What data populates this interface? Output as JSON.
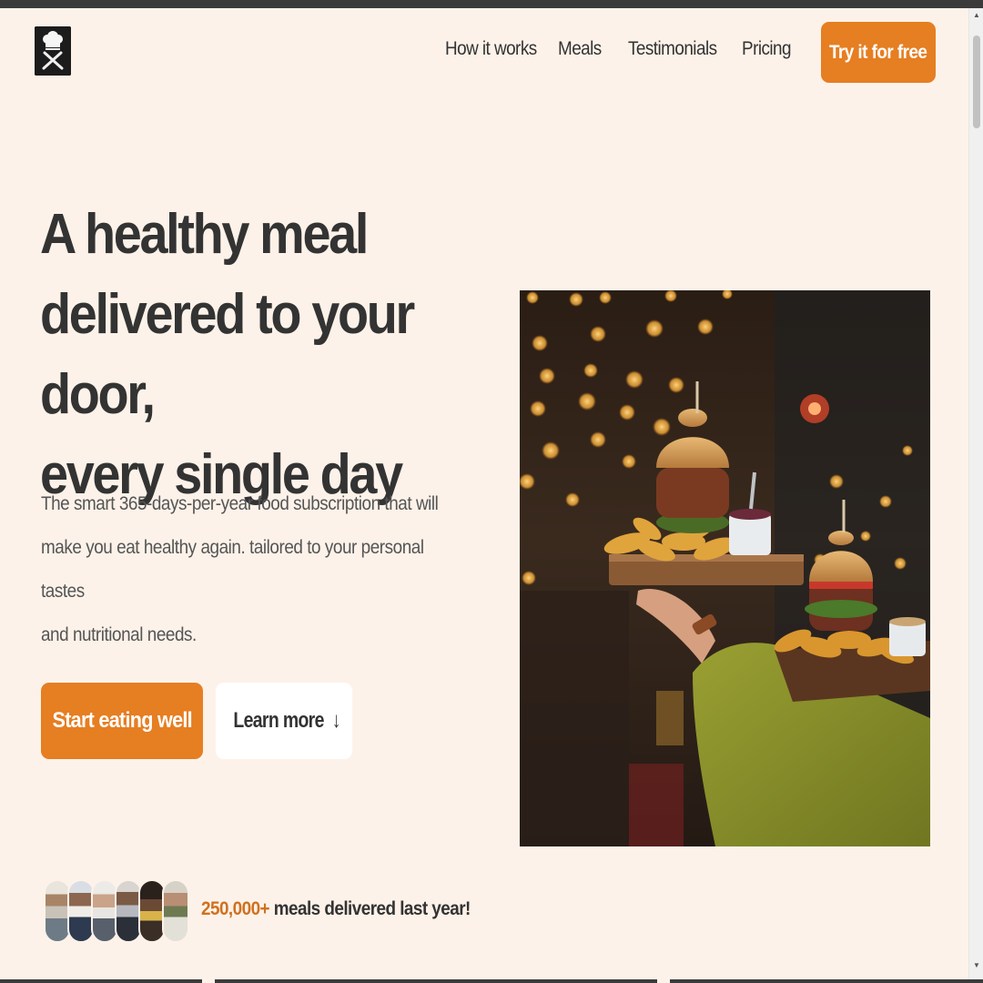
{
  "header": {
    "logo_icon": "chef-hat-cutlery-icon",
    "nav": [
      {
        "label": "How it works"
      },
      {
        "label": "Meals"
      },
      {
        "label": "Testimonials"
      },
      {
        "label": "Pricing"
      }
    ],
    "cta_label": "Try it for free"
  },
  "hero": {
    "title_lines": [
      "A healthy meal",
      "delivered to your door,",
      "every single day"
    ],
    "description_lines": [
      "The smart 365-days-per-year food subscription that will",
      "make you eat healthy again. tailored to your personal tastes",
      "and nutritional needs."
    ],
    "primary_button": "Start eating well",
    "secondary_button": "Learn more",
    "secondary_button_arrow": "↓",
    "image_subject": "burgers-and-fries-on-wooden-boards"
  },
  "delivered": {
    "count": "250,000+",
    "text": " meals delivered last year!",
    "avatar_count": 6
  },
  "colors": {
    "background": "#fdf2e9",
    "accent": "#e67e22",
    "text": "#333333"
  }
}
